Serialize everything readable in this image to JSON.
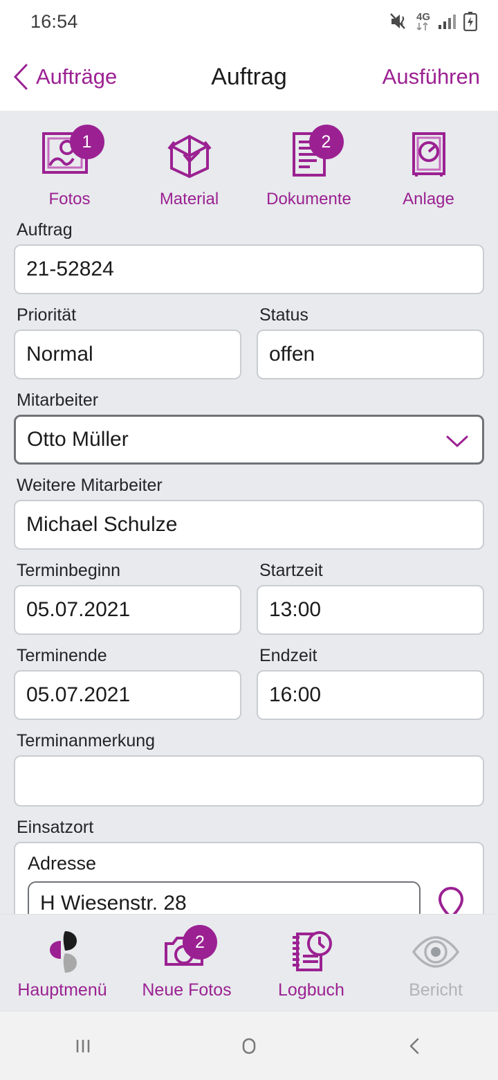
{
  "status_bar": {
    "time": "16:54",
    "network": "4G",
    "icons": [
      "mute-vibrate-icon",
      "data-transfer-icon",
      "signal-bars-icon",
      "battery-charging-icon"
    ]
  },
  "header": {
    "back_label": "Aufträge",
    "title": "Auftrag",
    "action_label": "Ausführen"
  },
  "tabs": [
    {
      "label": "Fotos",
      "badge": "1",
      "icon": "photo-frame-icon"
    },
    {
      "label": "Material",
      "badge": "",
      "icon": "open-box-icon"
    },
    {
      "label": "Dokumente",
      "badge": "2",
      "icon": "document-icon"
    },
    {
      "label": "Anlage",
      "badge": "",
      "icon": "gauge-device-icon"
    }
  ],
  "form": {
    "auftrag": {
      "label": "Auftrag",
      "value": "21-52824"
    },
    "prioritaet": {
      "label": "Priorität",
      "value": "Normal"
    },
    "status": {
      "label": "Status",
      "value": "offen"
    },
    "mitarbeiter": {
      "label": "Mitarbeiter",
      "value": "Otto Müller"
    },
    "weitere_mitarbeiter": {
      "label": "Weitere Mitarbeiter",
      "value": "Michael Schulze"
    },
    "terminbeginn": {
      "label": "Terminbeginn",
      "value": "05.07.2021"
    },
    "startzeit": {
      "label": "Startzeit",
      "value": "13:00"
    },
    "terminende": {
      "label": "Terminende",
      "value": "05.07.2021"
    },
    "endzeit": {
      "label": "Endzeit",
      "value": "16:00"
    },
    "terminanmerkung": {
      "label": "Terminanmerkung",
      "value": ""
    },
    "einsatzort": {
      "label": "Einsatzort",
      "adresse_label": "Adresse",
      "adresse_value": "H                      Wiesenstr. 28"
    }
  },
  "bottom_bar": [
    {
      "label": "Hauptmenü",
      "badge": "",
      "icon": "app-logo-icon",
      "disabled": false
    },
    {
      "label": "Neue Fotos",
      "badge": "2",
      "icon": "camera-icon",
      "disabled": false
    },
    {
      "label": "Logbuch",
      "badge": "",
      "icon": "notebook-clock-icon",
      "disabled": false
    },
    {
      "label": "Bericht",
      "badge": "",
      "icon": "eye-icon",
      "disabled": true
    }
  ],
  "android_nav": [
    "recents-icon",
    "home-icon",
    "back-icon"
  ],
  "colors": {
    "accent": "#9B2192",
    "background": "#E8EAED",
    "surface": "#FFFFFF",
    "border": "#C9CCD1",
    "border_focus": "#6F7276",
    "disabled": "#B0B3B8",
    "text": "#1B1B1B"
  }
}
